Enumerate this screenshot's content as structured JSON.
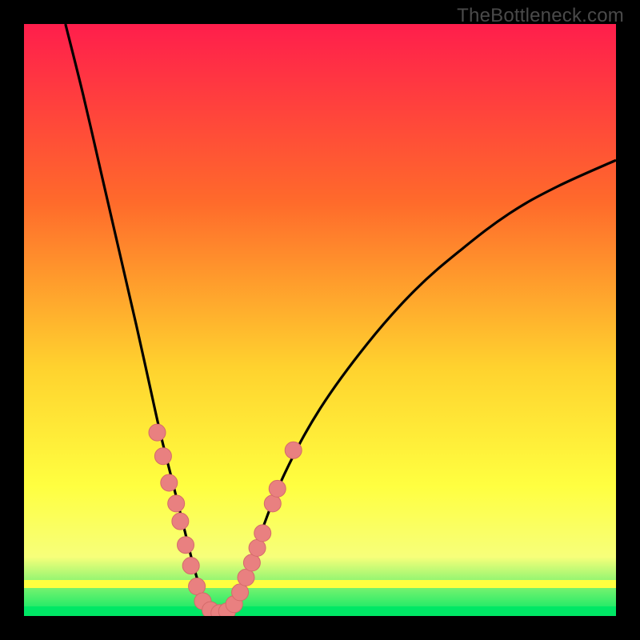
{
  "watermark": "TheBottleneck.com",
  "colors": {
    "bg": "#000000",
    "grad_top": "#ff1e4c",
    "grad_mid1": "#ff6a2b",
    "grad_mid2": "#ffd22e",
    "grad_mid3": "#ffff40",
    "grad_low": "#f7ff7a",
    "grad_bottom": "#00e765",
    "curve": "#000000",
    "dot_fill": "#e98080",
    "dot_stroke": "#d46a6a"
  },
  "chart_data": {
    "type": "line",
    "title": "",
    "xlabel": "",
    "ylabel": "",
    "xlim": [
      0,
      100
    ],
    "ylim": [
      0,
      100
    ],
    "curve_left": [
      {
        "x": 7,
        "y": 100
      },
      {
        "x": 10,
        "y": 88
      },
      {
        "x": 13,
        "y": 75
      },
      {
        "x": 16,
        "y": 62
      },
      {
        "x": 19,
        "y": 49
      },
      {
        "x": 21,
        "y": 40
      },
      {
        "x": 23,
        "y": 31
      },
      {
        "x": 25,
        "y": 23
      },
      {
        "x": 27,
        "y": 15
      },
      {
        "x": 28.5,
        "y": 9
      },
      {
        "x": 30,
        "y": 4
      },
      {
        "x": 31.5,
        "y": 1.5
      },
      {
        "x": 33,
        "y": 0.5
      }
    ],
    "curve_right": [
      {
        "x": 33,
        "y": 0.5
      },
      {
        "x": 35,
        "y": 2
      },
      {
        "x": 37,
        "y": 6
      },
      {
        "x": 40,
        "y": 14
      },
      {
        "x": 44,
        "y": 24
      },
      {
        "x": 50,
        "y": 35
      },
      {
        "x": 58,
        "y": 46
      },
      {
        "x": 66,
        "y": 55
      },
      {
        "x": 74,
        "y": 62
      },
      {
        "x": 82,
        "y": 68
      },
      {
        "x": 90,
        "y": 72.5
      },
      {
        "x": 100,
        "y": 77
      }
    ],
    "dots": [
      {
        "x": 22.5,
        "y": 31
      },
      {
        "x": 23.5,
        "y": 27
      },
      {
        "x": 24.5,
        "y": 22.5
      },
      {
        "x": 25.7,
        "y": 19
      },
      {
        "x": 26.4,
        "y": 16
      },
      {
        "x": 27.3,
        "y": 12
      },
      {
        "x": 28.2,
        "y": 8.5
      },
      {
        "x": 29.2,
        "y": 5
      },
      {
        "x": 30.2,
        "y": 2.5
      },
      {
        "x": 31.5,
        "y": 1
      },
      {
        "x": 33,
        "y": 0.5
      },
      {
        "x": 34.3,
        "y": 0.8
      },
      {
        "x": 35.5,
        "y": 2
      },
      {
        "x": 36.5,
        "y": 4
      },
      {
        "x": 37.5,
        "y": 6.5
      },
      {
        "x": 38.5,
        "y": 9
      },
      {
        "x": 39.4,
        "y": 11.5
      },
      {
        "x": 40.3,
        "y": 14
      },
      {
        "x": 42,
        "y": 19
      },
      {
        "x": 42.8,
        "y": 21.5
      },
      {
        "x": 45.5,
        "y": 28
      }
    ]
  }
}
